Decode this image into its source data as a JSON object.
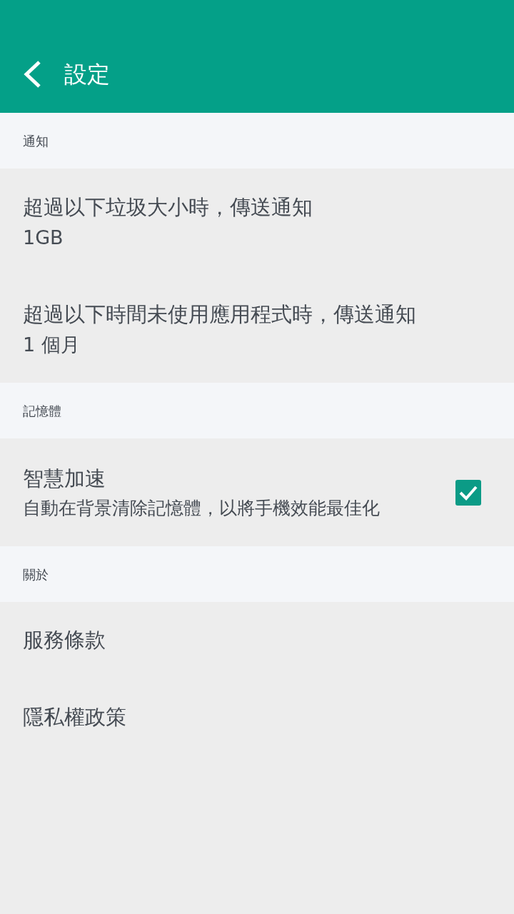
{
  "app_bar": {
    "title": "設定"
  },
  "sections": [
    {
      "title": "通知",
      "items": [
        {
          "kind": "value",
          "title": "超過以下垃圾大小時，傳送通知",
          "value": "1GB"
        },
        {
          "kind": "value",
          "title": "超過以下時間未使用應用程式時，傳送通知",
          "value": "1 個月"
        }
      ]
    },
    {
      "title": "記憶體",
      "items": [
        {
          "kind": "checkbox",
          "title": "智慧加速",
          "summary": "自動在背景清除記憶體，以將手機效能最佳化",
          "checked": true
        }
      ]
    },
    {
      "title": "關於",
      "items": [
        {
          "kind": "link",
          "title": "服務條款"
        },
        {
          "kind": "link",
          "title": "隱私權政策"
        }
      ]
    }
  ]
}
